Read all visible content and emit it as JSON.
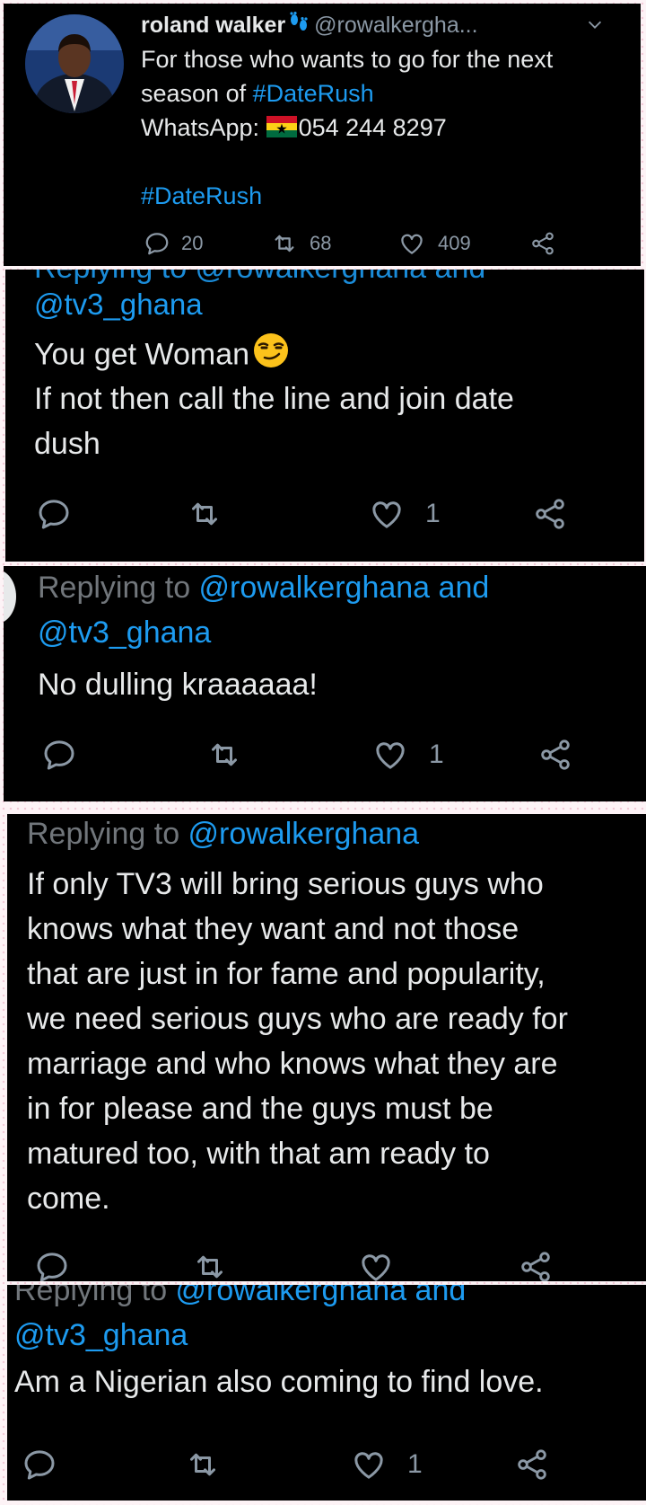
{
  "tweet1": {
    "display_name": "roland walker",
    "handle": "@rowalkergha...",
    "line1": "For those who wants to go for the next",
    "line2_prefix": "season of ",
    "line2_tag": "#DateRush",
    "line3_prefix": "WhatsApp: ",
    "line3_phone": "054 244 8297",
    "hashtag": "#DateRush",
    "replies": "20",
    "retweets": "68",
    "likes": "409"
  },
  "tweet2": {
    "reply_cutoff": "Replying to @rowalkerghana and",
    "mention_line": "@tv3_ghana",
    "line1": "You get Woman",
    "line2": "If not then call the line and join date",
    "line3": "dush",
    "likes": "1"
  },
  "tweet3": {
    "replying_to_label": "Replying to ",
    "mention1": "@rowalkerghana and",
    "mention2": "@tv3_ghana",
    "body": "No dulling kraaaaaa!",
    "likes": "1"
  },
  "tweet4": {
    "replying_to_label": "Replying to ",
    "mention1": "@rowalkerghana",
    "lines": [
      "If only TV3 will bring serious guys who",
      "knows what they want and not those",
      "that are just in for fame and popularity,",
      "we need serious guys who are ready for",
      "marriage and who knows what they are",
      "in for please and the guys must be",
      "matured too, with that am ready to",
      "come."
    ]
  },
  "tweet5": {
    "replying_to_label": "Replying to ",
    "mention1": "@rowalkerghana and",
    "mention2": "@tv3_ghana",
    "body": "Am a Nigerian also coming to find love.",
    "likes": "1"
  },
  "colors": {
    "link": "#1d9bf0",
    "text": "#e7e9ea",
    "muted": "#71767b",
    "background": "#000000"
  }
}
